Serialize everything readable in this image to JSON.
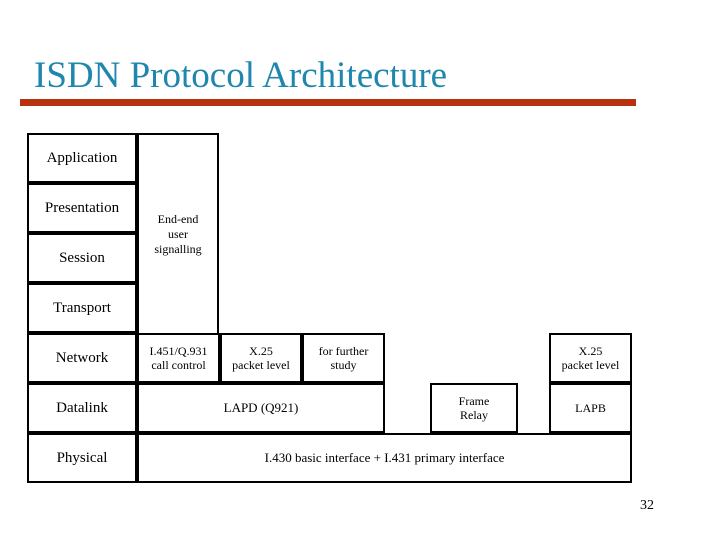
{
  "slide": {
    "title": "ISDN Protocol Architecture",
    "title_color": "#1f87ad",
    "rule_color": "#b73310",
    "background_color": "#ffffff",
    "page_number": "32"
  },
  "osi_layers": [
    {
      "label": "Application"
    },
    {
      "label": "Presentation"
    },
    {
      "label": "Session"
    },
    {
      "label": "Transport"
    },
    {
      "label": "Network"
    },
    {
      "label": "Datalink"
    },
    {
      "label": "Physical"
    }
  ],
  "boxes": {
    "end_end_signalling": {
      "line1": "End-end",
      "line2": "user",
      "line3": "signalling"
    },
    "network_call_control": {
      "line1": "I.451/Q.931",
      "line2": "call control"
    },
    "network_x25": {
      "line1": "X.25",
      "line2": "packet level"
    },
    "network_further_study": {
      "line1": "for further",
      "line2": "study"
    },
    "x25_right": {
      "line1": "X.25",
      "line2": "packet level"
    },
    "lapd": {
      "label": "LAPD (Q921)"
    },
    "frame_relay": {
      "line1": "Frame",
      "line2": "Relay"
    },
    "lapb": {
      "label": "LAPB"
    },
    "physical": {
      "label": "I.430 basic interface + I.431 primary interface"
    }
  }
}
